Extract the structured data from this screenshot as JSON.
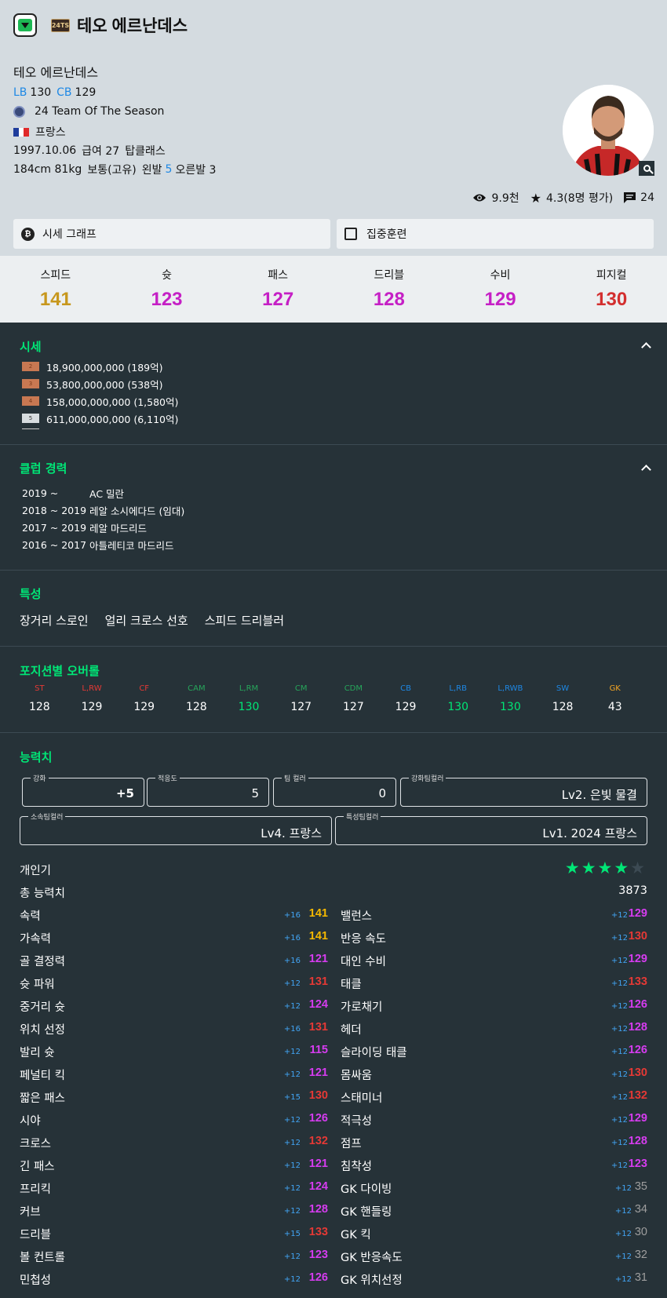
{
  "header": {
    "title": "테오 에르난데스",
    "season_badge": "24TS",
    "player_name": "테오 에르난데스",
    "positions": [
      {
        "pos": "LB",
        "ovr": "130"
      },
      {
        "pos": "CB",
        "ovr": "129"
      }
    ],
    "season": "24 Team Of The Season",
    "nation": "프랑스",
    "birth": "1997.10.06",
    "salary": "급여 27",
    "class": "탑클래스",
    "body": "184cm 81kg",
    "build": "보통(고유)",
    "left_foot_label": "왼발",
    "left_foot": "5",
    "right_foot": "오른발 3",
    "views": "9.9천",
    "rating": "4.3(8명 평가)",
    "comments": "24"
  },
  "buttons": {
    "price_graph": "시세 그래프",
    "training": "집중훈련"
  },
  "overview": [
    {
      "label": "스피드",
      "value": "141",
      "color": "#c7971d"
    },
    {
      "label": "슛",
      "value": "123",
      "color": "#c51fc5"
    },
    {
      "label": "패스",
      "value": "127",
      "color": "#c51fc5"
    },
    {
      "label": "드리블",
      "value": "128",
      "color": "#c51fc5"
    },
    {
      "label": "수비",
      "value": "129",
      "color": "#c51fc5"
    },
    {
      "label": "피지컬",
      "value": "130",
      "color": "#d32f2f"
    }
  ],
  "price": {
    "title": "시세",
    "rows": [
      {
        "level": "2",
        "kind": "bronze",
        "text": "18,900,000,000 (189억)"
      },
      {
        "level": "3",
        "kind": "bronze",
        "text": "53,800,000,000 (538억)"
      },
      {
        "level": "4",
        "kind": "bronze",
        "text": "158,000,000,000 (1,580억)"
      },
      {
        "level": "5",
        "kind": "silver",
        "text": "611,000,000,000 (6,110억)"
      }
    ]
  },
  "career": {
    "title": "클럽 경력",
    "rows": [
      {
        "years": "2019 ~          ",
        "club": "AC 밀란"
      },
      {
        "years": "2018 ~ 2019 ",
        "club": "레알 소시에다드 (임대)"
      },
      {
        "years": "2017 ~ 2019 ",
        "club": "레알 마드리드"
      },
      {
        "years": "2016 ~ 2017 ",
        "club": "아틀레티코 마드리드"
      }
    ]
  },
  "traits": {
    "title": "특성",
    "items": [
      "장거리 스로인",
      "얼리 크로스 선호",
      "스피드 드리블러"
    ]
  },
  "positions": {
    "title": "포지션별 오버롤",
    "cells": [
      {
        "pos": "ST",
        "val": "128",
        "pcolor": "#e53935",
        "vcolor": "#ffffff"
      },
      {
        "pos": "L,RW",
        "val": "129",
        "pcolor": "#e53935",
        "vcolor": "#ffffff"
      },
      {
        "pos": "CF",
        "val": "129",
        "pcolor": "#e53935",
        "vcolor": "#ffffff"
      },
      {
        "pos": "CAM",
        "val": "128",
        "pcolor": "#26a65b",
        "vcolor": "#ffffff"
      },
      {
        "pos": "L,RM",
        "val": "130",
        "pcolor": "#26a65b",
        "vcolor": "#00e676"
      },
      {
        "pos": "CM",
        "val": "127",
        "pcolor": "#26a65b",
        "vcolor": "#ffffff"
      },
      {
        "pos": "CDM",
        "val": "127",
        "pcolor": "#26a65b",
        "vcolor": "#ffffff"
      },
      {
        "pos": "CB",
        "val": "129",
        "pcolor": "#1e88e5",
        "vcolor": "#ffffff"
      },
      {
        "pos": "L,RB",
        "val": "130",
        "pcolor": "#1e88e5",
        "vcolor": "#00e676"
      },
      {
        "pos": "L,RWB",
        "val": "130",
        "pcolor": "#1e88e5",
        "vcolor": "#00e676"
      },
      {
        "pos": "SW",
        "val": "128",
        "pcolor": "#1e88e5",
        "vcolor": "#ffffff"
      },
      {
        "pos": "GK",
        "val": "43",
        "pcolor": "#f5a623",
        "vcolor": "#ffffff"
      }
    ]
  },
  "ability": {
    "title": "능력치",
    "fields": {
      "enhance_label": "강화",
      "enhance_value": "+5",
      "fit_label": "적응도",
      "fit_value": "5",
      "teamcolor_label": "팀 컬러",
      "teamcolor_value": "0",
      "enh_teamcolor_label": "강화팀컬러",
      "enh_teamcolor_value": "Lv2. 은빛 물결",
      "club_teamcolor_label": "소속팀컬러",
      "club_teamcolor_value": "Lv4. 프랑스",
      "trait_teamcolor_label": "특성팀컬러",
      "trait_teamcolor_value": "Lv1. 2024 프랑스"
    },
    "popularity_label": "개인기",
    "popularity_stars": 4,
    "popularity_max": 5,
    "total_label": "총 능력치",
    "total_value": "3873",
    "left": [
      {
        "name": "속력",
        "plus": "+16",
        "val": "141",
        "color": "#f5b800"
      },
      {
        "name": "가속력",
        "plus": "+16",
        "val": "141",
        "color": "#f5b800"
      },
      {
        "name": "골 결정력",
        "plus": "+16",
        "val": "121",
        "color": "#d63cf0"
      },
      {
        "name": "슛 파워",
        "plus": "+12",
        "val": "131",
        "color": "#e53935"
      },
      {
        "name": "중거리 슛",
        "plus": "+12",
        "val": "124",
        "color": "#d63cf0"
      },
      {
        "name": "위치 선정",
        "plus": "+16",
        "val": "131",
        "color": "#e53935"
      },
      {
        "name": "발리 슛",
        "plus": "+12",
        "val": "115",
        "color": "#d63cf0"
      },
      {
        "name": "페널티 킥",
        "plus": "+12",
        "val": "121",
        "color": "#d63cf0"
      },
      {
        "name": "짧은 패스",
        "plus": "+15",
        "val": "130",
        "color": "#e53935"
      },
      {
        "name": "시야",
        "plus": "+12",
        "val": "126",
        "color": "#d63cf0"
      },
      {
        "name": "크로스",
        "plus": "+12",
        "val": "132",
        "color": "#e53935"
      },
      {
        "name": "긴 패스",
        "plus": "+12",
        "val": "121",
        "color": "#d63cf0"
      },
      {
        "name": "프리킥",
        "plus": "+12",
        "val": "124",
        "color": "#d63cf0"
      },
      {
        "name": "커브",
        "plus": "+12",
        "val": "128",
        "color": "#d63cf0"
      },
      {
        "name": "드리블",
        "plus": "+15",
        "val": "133",
        "color": "#e53935"
      },
      {
        "name": "볼 컨트롤",
        "plus": "+12",
        "val": "123",
        "color": "#d63cf0"
      },
      {
        "name": "민첩성",
        "plus": "+12",
        "val": "126",
        "color": "#d63cf0"
      }
    ],
    "right": [
      {
        "name": "밸런스",
        "plus": "+12",
        "val": "129",
        "color": "#d63cf0"
      },
      {
        "name": "반응 속도",
        "plus": "+12",
        "val": "130",
        "color": "#e53935"
      },
      {
        "name": "대인 수비",
        "plus": "+12",
        "val": "129",
        "color": "#d63cf0"
      },
      {
        "name": "태클",
        "plus": "+12",
        "val": "133",
        "color": "#e53935"
      },
      {
        "name": "가로채기",
        "plus": "+12",
        "val": "126",
        "color": "#d63cf0"
      },
      {
        "name": "헤더",
        "plus": "+12",
        "val": "128",
        "color": "#d63cf0"
      },
      {
        "name": "슬라이딩 태클",
        "plus": "+12",
        "val": "126",
        "color": "#d63cf0"
      },
      {
        "name": "몸싸움",
        "plus": "+12",
        "val": "130",
        "color": "#e53935"
      },
      {
        "name": "스태미너",
        "plus": "+12",
        "val": "132",
        "color": "#e53935"
      },
      {
        "name": "적극성",
        "plus": "+12",
        "val": "129",
        "color": "#d63cf0"
      },
      {
        "name": "점프",
        "plus": "+12",
        "val": "128",
        "color": "#d63cf0"
      },
      {
        "name": "침착성",
        "plus": "+12",
        "val": "123",
        "color": "#d63cf0"
      },
      {
        "name": "GK 다이빙",
        "plus": "+12",
        "val": "35",
        "color": "#9e9e9e"
      },
      {
        "name": "GK 핸들링",
        "plus": "+12",
        "val": "34",
        "color": "#9e9e9e"
      },
      {
        "name": "GK 킥",
        "plus": "+12",
        "val": "30",
        "color": "#9e9e9e"
      },
      {
        "name": "GK 반응속도",
        "plus": "+12",
        "val": "32",
        "color": "#9e9e9e"
      },
      {
        "name": "GK 위치선정",
        "plus": "+12",
        "val": "31",
        "color": "#9e9e9e"
      }
    ]
  }
}
